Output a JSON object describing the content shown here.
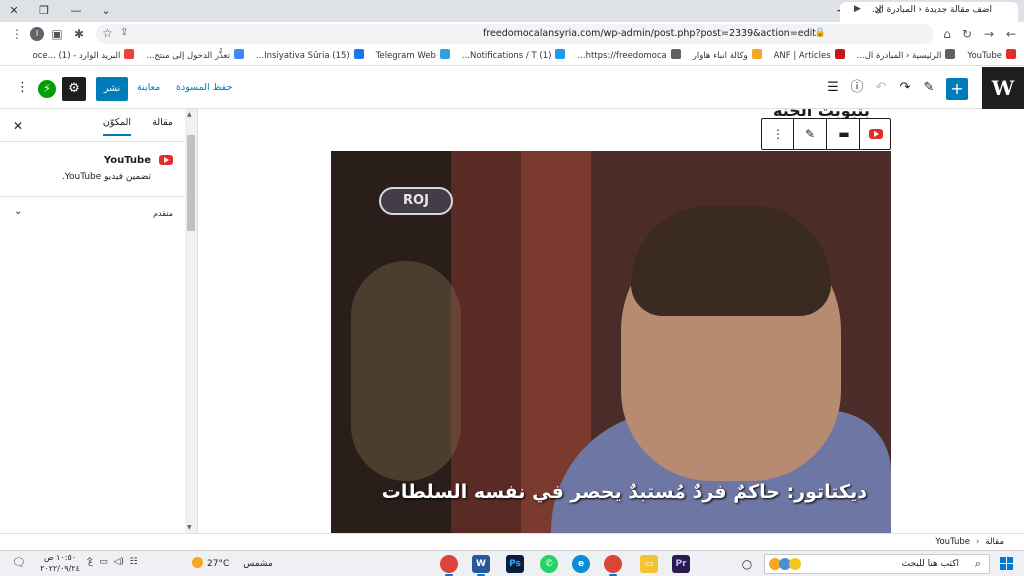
{
  "browser": {
    "tab_title": "أضف مقالة جديدة ‹ المبادرة ال...",
    "url": "freedomocalansyria.com/wp-admin/post.php?post=2339&action=edit",
    "profile_letter": "I"
  },
  "bookmarks": [
    {
      "label": "YouTube",
      "color": "#e52d27"
    },
    {
      "label": "الرئيسية ‹ المبادرة ال...",
      "color": "#5f6368"
    },
    {
      "label": "ANF | Articles",
      "color": "#c4161c"
    },
    {
      "label": "وكالة انباء هاوار",
      "color": "#f5a623"
    },
    {
      "label": "https://freedomoca...",
      "color": "#5f6368"
    },
    {
      "label": "(1) Notifications / T...",
      "color": "#1d9bf0"
    },
    {
      "label": "Telegram Web",
      "color": "#2aa3df"
    },
    {
      "label": "(15) Insiyativa Sûria...",
      "color": "#1877f2"
    },
    {
      "label": "تعذُّر الدخول إلى منتج...",
      "color": "#4285f4"
    },
    {
      "label": "البريد الوارد - oce... (1)",
      "color": "#ea4335"
    }
  ],
  "editor": {
    "publish_label": "نشر",
    "preview_label": "معاينة",
    "save_draft_label": "حفظ المسودة",
    "title_fragment": "بتيوبت الحنة"
  },
  "sidebar": {
    "tab_post": "مقالة",
    "tab_block": "المكوّن",
    "block_name": "YouTube",
    "block_description": "تضمين فيديو YouTube.",
    "advanced_label": "متقدم"
  },
  "video": {
    "channel_logo": "ROJ",
    "subtitle": "ديكتاتور: حاكمٌ فردٌ مُستبدٌ يحصر في نفسه السلطات"
  },
  "breadcrumb": {
    "root": "مقالة",
    "current": "YouTube"
  },
  "taskbar": {
    "search_placeholder": "اكتب هنا للبحث",
    "weather_temp": "27°C",
    "weather_condition": "مشمس",
    "time": "١٠:٥٠ ص",
    "date": "٢٠٢٢/٠٩/٢٤",
    "lang": "ع"
  },
  "colors": {
    "wp_blue": "#007cba",
    "youtube_red": "#e52d27",
    "jetpack_green": "#069e08"
  }
}
